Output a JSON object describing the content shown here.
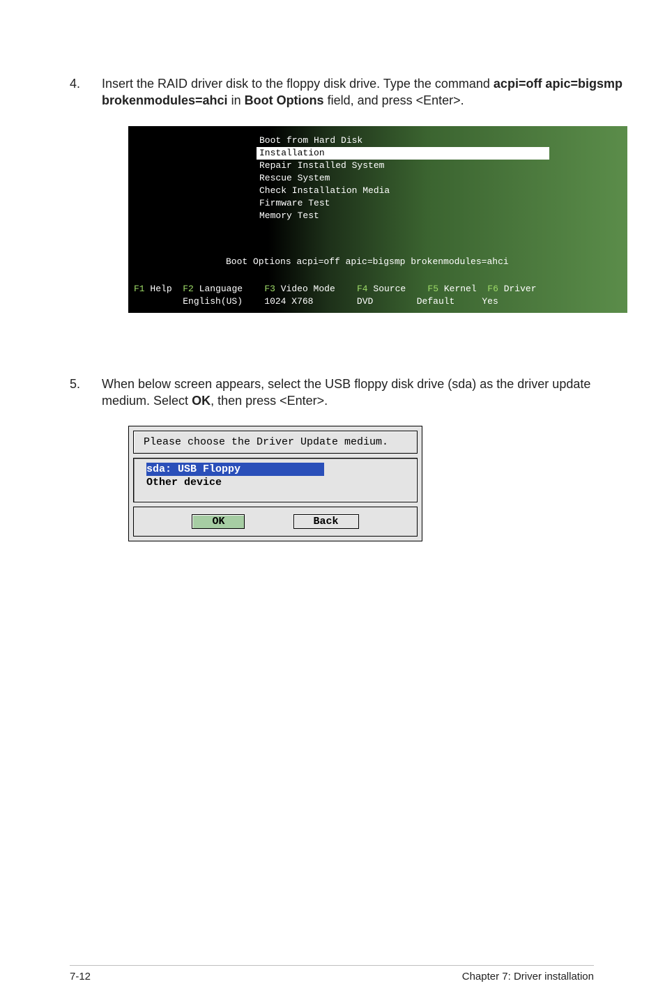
{
  "step4": {
    "number": "4.",
    "text_before_bold_cmd": "Insert the RAID driver disk to the floppy disk drive. Type the command ",
    "cmd_bold": "acpi=off apic=bigsmp brokenmodules=ahci",
    "text_after_cmd": " in ",
    "boot_options_bold": "Boot Options",
    "text_after_boot_options": " field, and press <Enter>."
  },
  "boot_menu": {
    "items": [
      {
        "label": "Boot from Hard Disk",
        "selected": false
      },
      {
        "label": "Installation",
        "selected": true
      },
      {
        "label": "Repair Installed System",
        "selected": false
      },
      {
        "label": "Rescue System",
        "selected": false
      },
      {
        "label": "Check Installation Media",
        "selected": false
      },
      {
        "label": "Firmware Test",
        "selected": false
      },
      {
        "label": "Memory Test",
        "selected": false
      }
    ],
    "options_line": "Boot Options acpi=off apic=bigsmp brokenmodules=ahci",
    "fkeys": {
      "f1": "F1",
      "f1_label": "Help",
      "f2": "F2",
      "f2_label": "Language",
      "f2_value": "English(US)",
      "f3": "F3",
      "f3_label": "Video Mode",
      "f3_value": "1024 X768",
      "f4": "F4",
      "f4_label": "Source",
      "f4_value": "DVD",
      "f5": "F5",
      "f5_label": "Kernel",
      "f5_value": "Default",
      "f6": "F6",
      "f6_label": "Driver",
      "f6_value": "Yes"
    }
  },
  "step5": {
    "number": "5.",
    "text_before_ok": "When below screen appears, select the USB floppy disk drive (sda) as the driver update medium. Select ",
    "ok_bold": "OK",
    "text_after_ok": ", then press <Enter>."
  },
  "dialog": {
    "title": "Please choose the Driver Update medium.",
    "items": {
      "sel": "sda: USB Floppy",
      "other": "Other device"
    },
    "buttons": {
      "ok": "OK",
      "back": "Back"
    }
  },
  "footer": {
    "left": "7-12",
    "right": "Chapter 7: Driver installation"
  }
}
